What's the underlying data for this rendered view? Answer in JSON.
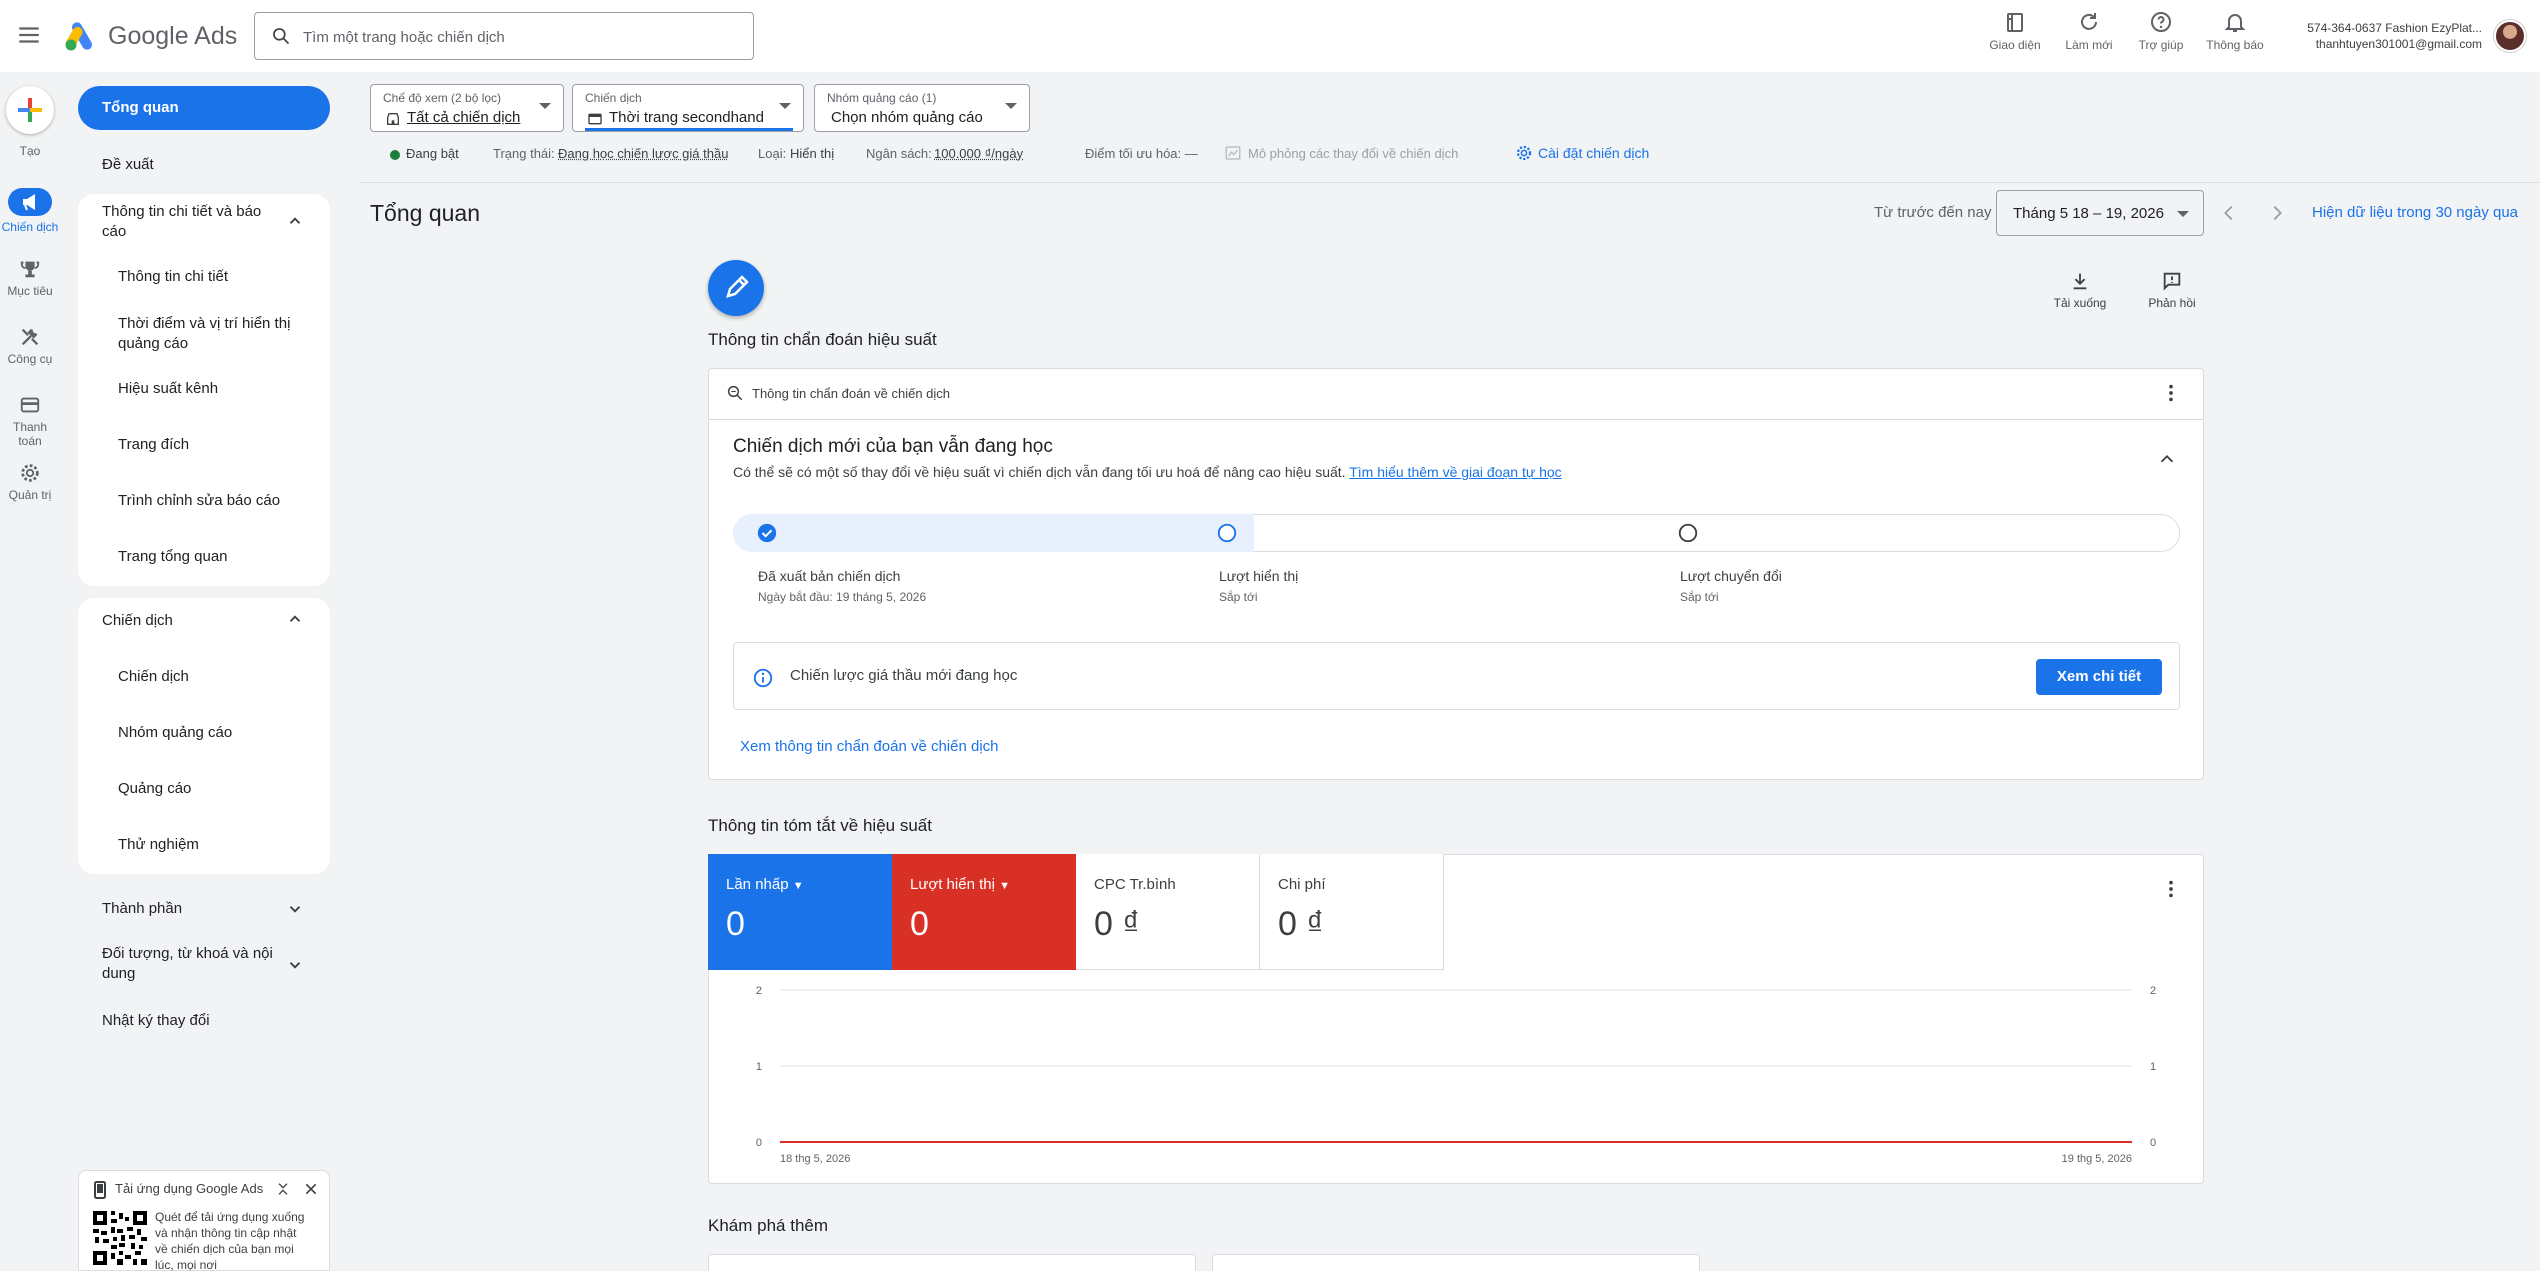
{
  "app": {
    "brand": "Google Ads",
    "search_placeholder": "Tìm một trang hoặc chiến dịch"
  },
  "topbar": {
    "actions": [
      {
        "label": "Giao diện",
        "icon": "appearance-icon"
      },
      {
        "label": "Làm mới",
        "icon": "refresh-icon"
      },
      {
        "label": "Trợ giúp",
        "icon": "help-icon"
      },
      {
        "label": "Thông báo",
        "icon": "notifications-icon"
      }
    ],
    "account_line1": "574-364-0637 Fashion EzyPlat...",
    "account_line2": "thanhtuyen301001@gmail.com"
  },
  "rail": {
    "items": [
      {
        "label": "Tạo",
        "icon": "create-plus-icon"
      },
      {
        "label": "Chiến dịch",
        "icon": "campaign-megaphone-icon",
        "active": true
      },
      {
        "label": "Mục tiêu",
        "icon": "goals-trophy-icon"
      },
      {
        "label": "Công cụ",
        "icon": "tools-icon"
      },
      {
        "label": "Thanh toán",
        "icon": "billing-card-icon"
      },
      {
        "label": "Quản trị",
        "icon": "admin-gear-icon"
      }
    ]
  },
  "nav": {
    "overview": "Tổng quan",
    "recommendations": "Đề xuất",
    "insights_group": {
      "title_line1": "Thông tin chi tiết và báo",
      "title_line2": "cáo",
      "items": [
        "Thông tin chi tiết",
        "Thời điểm và vị trí hiển thị",
        "quảng cáo",
        "Hiệu suất kênh",
        "Trang đích",
        "Trình chỉnh sửa báo cáo",
        "Trang tổng quan"
      ]
    },
    "campaigns_group": {
      "title": "Chiến dịch",
      "items": [
        "Chiến dịch",
        "Nhóm quảng cáo",
        "Quảng cáo",
        "Thử nghiệm"
      ]
    },
    "assets": "Thành phần",
    "audiences_line1": "Đối tượng, từ khoá và nội",
    "audiences_line2": "dung",
    "change_history": "Nhật ký thay đổi"
  },
  "filters": {
    "view_mode": {
      "label": "Chế độ xem (2 bộ lọc)",
      "value": "Tất cả chiến dịch"
    },
    "campaign": {
      "label": "Chiến dịch",
      "value": "Thời trang secondhand"
    },
    "ad_group": {
      "label": "Nhóm quảng cáo (1)",
      "value": "Chọn nhóm quảng cáo"
    }
  },
  "status_row": {
    "enabled": "Đang bật",
    "status_label": "Trạng thái:",
    "status_value": "Đang học chiến lược giá thầu",
    "type_label": "Loại:",
    "type_value": "Hiển thị",
    "budget_label": "Ngân sách:",
    "budget_value": "100.000 ₫/ngày",
    "opt_score": "Điểm tối ưu hóa: —",
    "simulate": "Mô phỏng các thay đổi về chiến dịch",
    "settings": "Cài đặt chiến dịch"
  },
  "page": {
    "title": "Tổng quan",
    "date_label": "Từ trước đến nay",
    "date_value": "Tháng 5 18 – 19, 2026",
    "last30": "Hiện dữ liệu trong 30 ngày qua",
    "download": "Tải xuống",
    "feedback": "Phản hồi"
  },
  "diagnostics": {
    "section_title": "Thông tin chẩn đoán hiệu suất",
    "card_header": "Thông tin chẩn đoán về chiến dịch",
    "headline": "Chiến dịch mới của bạn vẫn đang học",
    "description": "Có thể sẽ có một số thay đổi về hiệu suất vì chiến dịch vẫn đang tối ưu hoá để nâng cao hiệu suất.",
    "learn_more": "Tìm hiểu thêm về giai đoạn tự học",
    "steps": [
      {
        "title": "Đã xuất bản chiến dịch",
        "sub": "Ngày bắt đầu: 19 tháng 5, 2026",
        "done": true
      },
      {
        "title": "Lượt hiển thị",
        "sub": "Sắp tới",
        "done": false
      },
      {
        "title": "Lượt chuyển đổi",
        "sub": "Sắp tới",
        "done": false
      }
    ],
    "progress_fraction": 0.36,
    "bid_strategy_msg": "Chiến lược giá thầu mới đang học",
    "view_details": "Xem chi tiết",
    "view_diagnostics": "Xem thông tin chẩn đoán về chiến dịch"
  },
  "summary": {
    "section_title": "Thông tin tóm tắt về hiệu suất",
    "metrics": [
      {
        "label": "Lần nhấp",
        "value": "0",
        "color": "#1a73e8",
        "dropdown": true
      },
      {
        "label": "Lượt hiển thị",
        "value": "0",
        "color": "#d93025",
        "dropdown": true
      },
      {
        "label": "CPC Tr.bình",
        "value": "0 ₫",
        "color": "#ffffff"
      },
      {
        "label": "Chi phí",
        "value": "0 ₫",
        "color": "#ffffff"
      }
    ]
  },
  "chart_data": {
    "type": "line",
    "x": [
      "18 thg 5, 2026",
      "19 thg 5, 2026"
    ],
    "series": [
      {
        "name": "Lần nhấp",
        "values": [
          0,
          0
        ],
        "color": "#1a73e8"
      },
      {
        "name": "Lượt hiển thị",
        "values": [
          0,
          0
        ],
        "color": "#d93025"
      }
    ],
    "ylim": [
      0,
      2
    ],
    "yticks_left": [
      "0",
      "1",
      "2"
    ],
    "yticks_right": [
      "0",
      "1",
      "2"
    ],
    "grid": true
  },
  "explore": {
    "section_title": "Khám phá thêm"
  },
  "qr_panel": {
    "title": "Tải ứng dụng Google Ads",
    "text_line1": "Quét để tải ứng dụng xuống",
    "text_line2": "và nhận thông tin cập nhật",
    "text_line3": "về chiến dịch của bạn mọi",
    "text_line4": "lúc, mọi nơi"
  }
}
